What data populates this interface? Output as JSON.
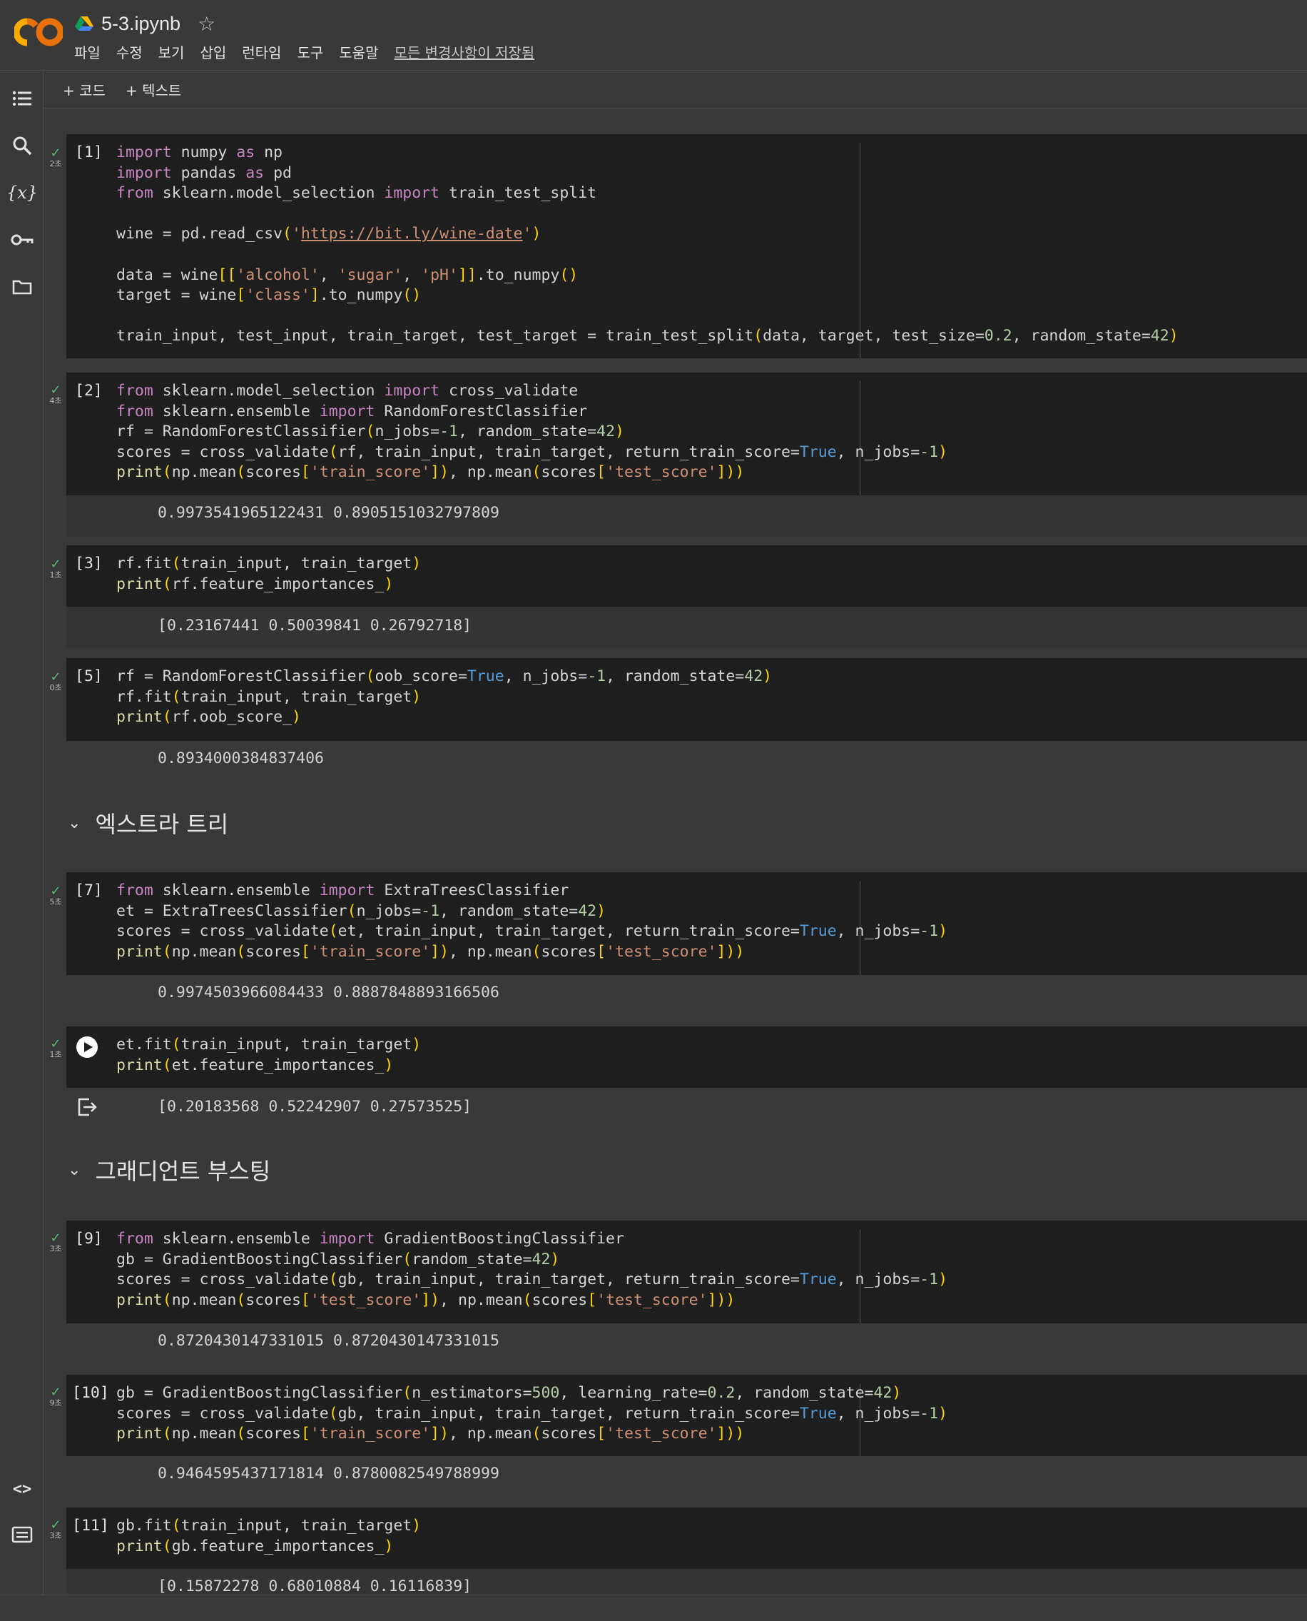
{
  "header": {
    "title": "5-3.ipynb",
    "menu": [
      "파일",
      "수정",
      "보기",
      "삽입",
      "런타임",
      "도구",
      "도움말"
    ],
    "saved_status": "모든 변경사항이 저장됨"
  },
  "toolbar": {
    "add_code": "+ 코드",
    "add_text": "+ 텍스트"
  },
  "sidebar_icons": [
    "table-of-contents-icon",
    "search-icon",
    "variables-icon",
    "secrets-key-icon",
    "files-folder-icon",
    "code-snippets-icon",
    "terminal-icon"
  ],
  "cells": [
    {
      "prompt": "[1]",
      "time": "2초"
    },
    {
      "prompt": "[2]",
      "time": "4초",
      "output": "0.9973541965122431 0.8905151032797809"
    },
    {
      "prompt": "[3]",
      "time": "1초",
      "output": "[0.23167441 0.50039841 0.26792718]"
    },
    {
      "prompt": "[5]",
      "time": "0초",
      "output": "0.8934000384837406"
    },
    {
      "prompt": "[7]",
      "time": "5초",
      "output": "0.9974503966084433 0.8887848893166506"
    },
    {
      "prompt": "",
      "time": "1초",
      "output": "[0.20183568 0.52242907 0.27573525]"
    },
    {
      "prompt": "[9]",
      "time": "3초",
      "output": "0.8720430147331015 0.8720430147331015"
    },
    {
      "prompt": "[10]",
      "time": "9초",
      "output": "0.9464595437171814 0.8780082549788999"
    },
    {
      "prompt": "[11]",
      "time": "3초",
      "output": "[0.15872278 0.68010884 0.16116839]"
    }
  ],
  "sections": [
    "엑스트라 트리",
    "그래디언트 부스팅"
  ],
  "colors": {
    "keyword": "#c586c0",
    "string": "#ce9178",
    "number": "#b5cea8",
    "boolean": "#569cd6",
    "function": "#dcdcaa",
    "check": "#5bb974"
  }
}
